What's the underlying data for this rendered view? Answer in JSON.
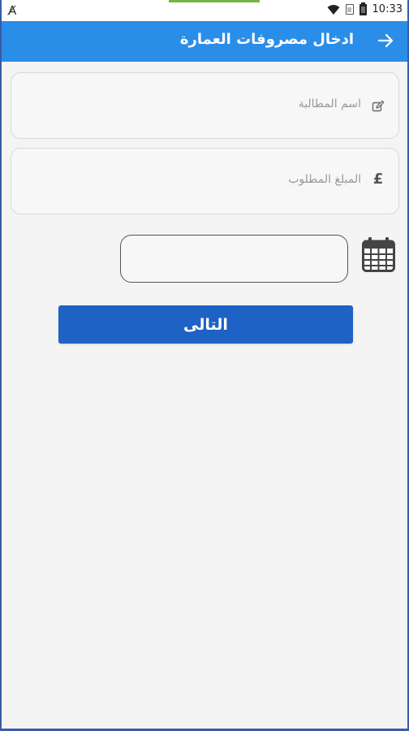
{
  "status_bar": {
    "left_icon": "A̸",
    "time": "10:33"
  },
  "app_bar": {
    "title": "ادخال مصروفات العمارة",
    "back_icon": "arrow-right"
  },
  "form": {
    "claim_name": {
      "placeholder": "اسم المطالبة",
      "icon": "edit"
    },
    "amount": {
      "placeholder": "المبلغ المطلوب",
      "icon": "£"
    },
    "date": {
      "value": ""
    }
  },
  "next_button": {
    "label": "التالى"
  },
  "colors": {
    "app_bar": "#2a8ee9",
    "button": "#1d62c4",
    "background": "#f4f4f4"
  }
}
